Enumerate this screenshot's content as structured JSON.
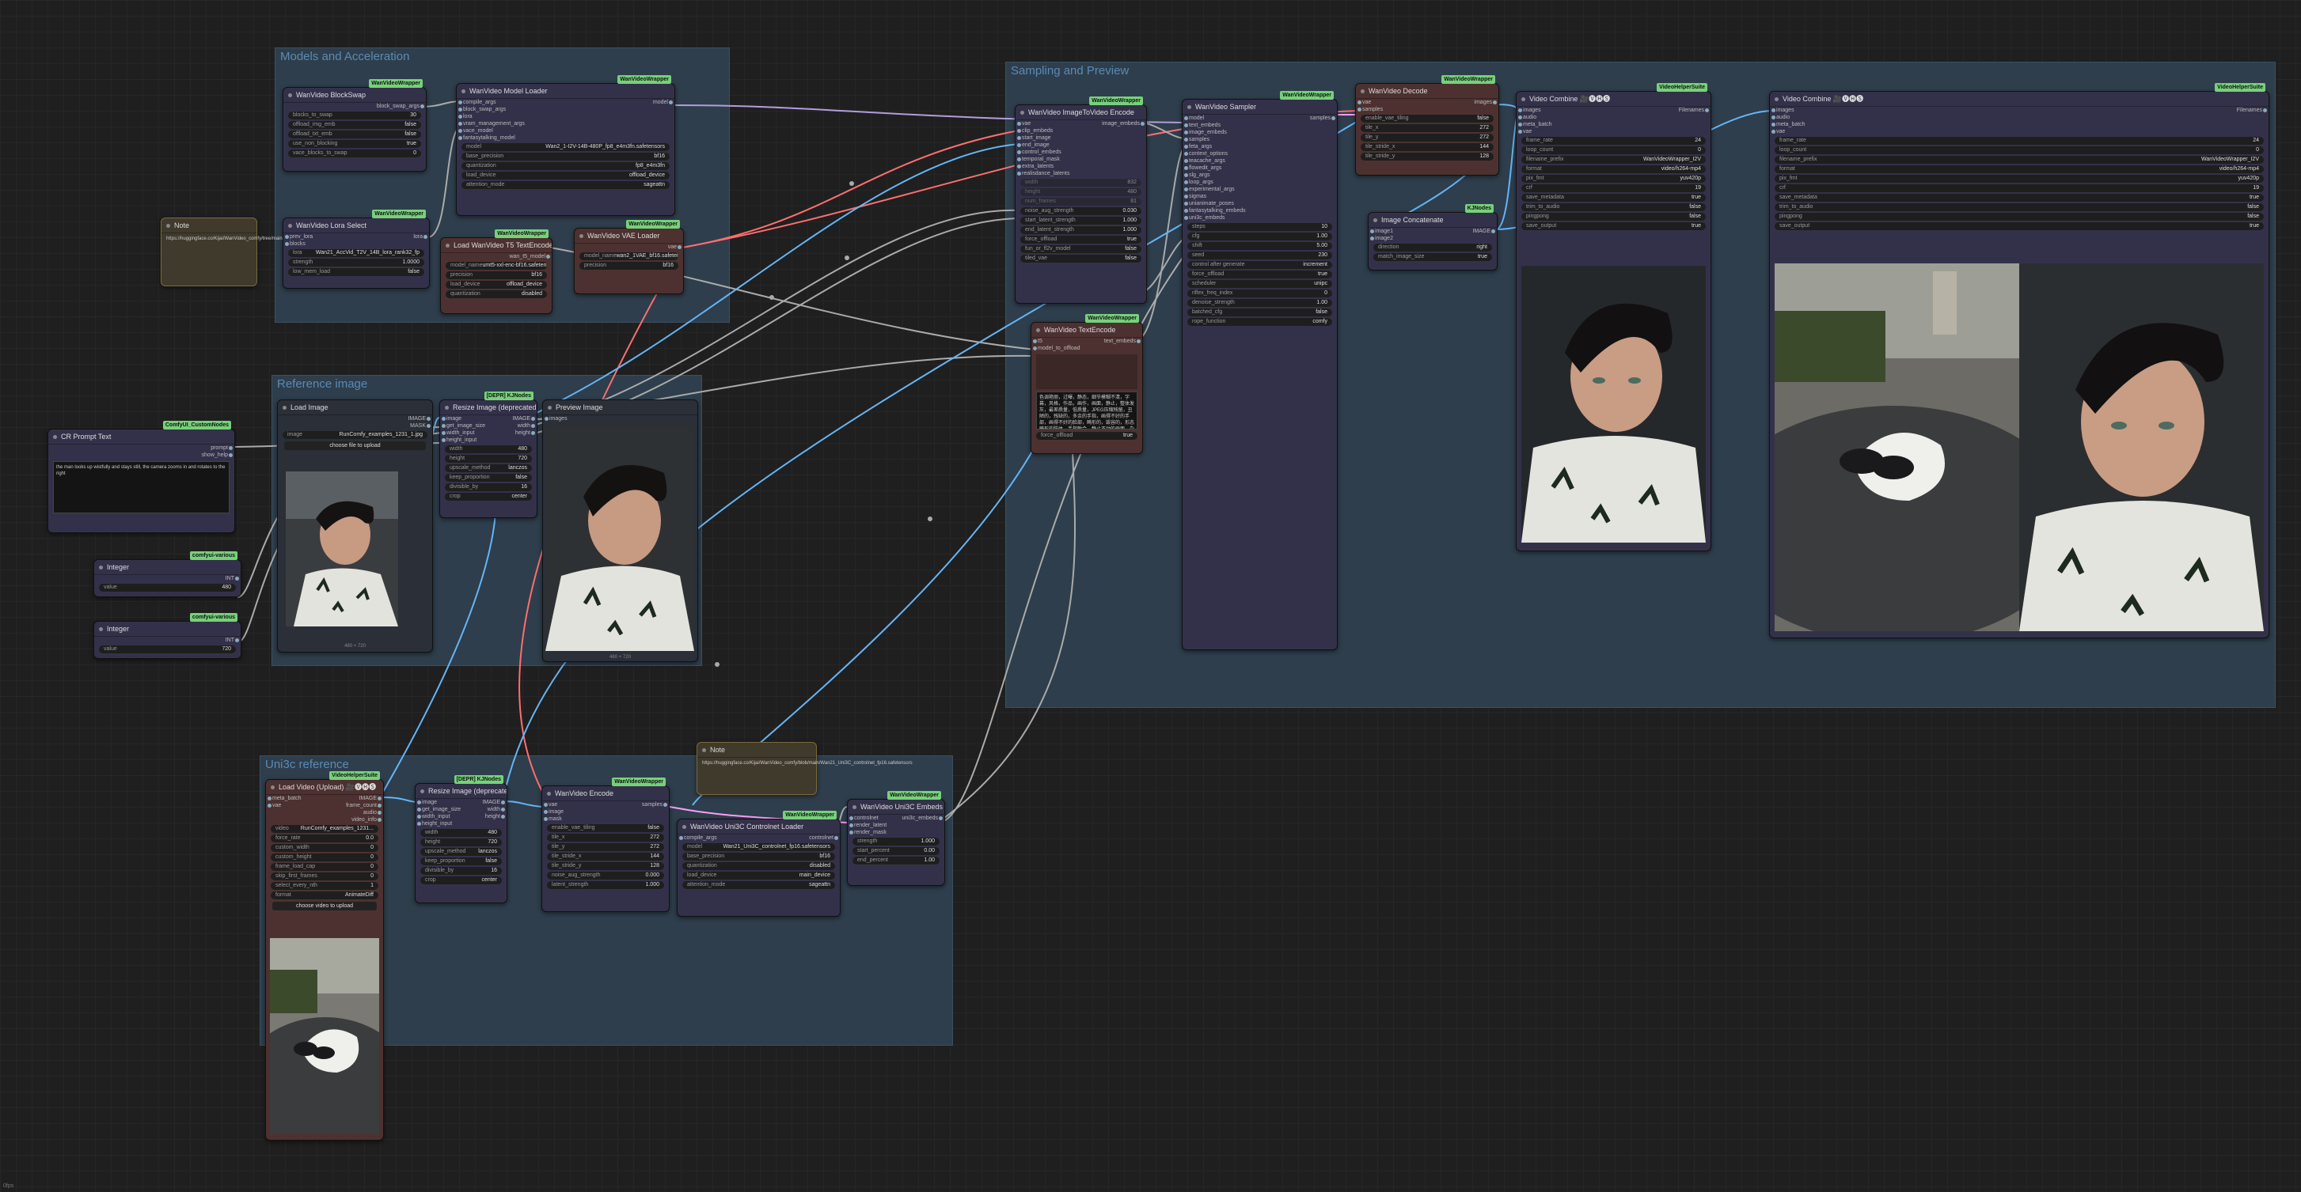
{
  "canvas": {
    "corner_label": "0fps"
  },
  "groups": {
    "models": "Models and Acceleration",
    "reference": "Reference image",
    "sampling": "Sampling and Preview",
    "uni3c": "Uni3c reference"
  },
  "nodes": {
    "blockswap": {
      "title": "WanVideo BlockSwap",
      "badge": "WanVideoWrapper",
      "output": "block_swap_args",
      "widgets": [
        [
          "blocks_to_swap",
          "30"
        ],
        [
          "offload_img_emb",
          "false"
        ],
        [
          "offload_txt_emb",
          "false"
        ],
        [
          "use_non_blocking",
          "true"
        ],
        [
          "vace_blocks_to_swap",
          "0"
        ]
      ]
    },
    "model_loader": {
      "title": "WanVideo Model Loader",
      "badge": "WanVideoWrapper",
      "output": "model",
      "inputs": [
        "compile_args",
        "block_swap_args",
        "lora",
        "vram_management_args",
        "vace_model",
        "fantasytalking_model"
      ],
      "widgets": [
        [
          "model",
          "Wan2_1-I2V-14B-480P_fp8_e4m3fn.safetensors"
        ],
        [
          "base_precision",
          "bf16"
        ],
        [
          "quantization",
          "fp8_e4m3fn"
        ],
        [
          "load_device",
          "offload_device"
        ],
        [
          "attention_mode",
          "sageattn"
        ]
      ]
    },
    "lora": {
      "title": "WanVideo Lora Select",
      "badge": "WanVideoWrapper",
      "output": "lora",
      "inputs": [
        "prev_lora",
        "blocks"
      ],
      "widgets": [
        [
          "lora",
          "Wan21_AccVid_T2V_14B_lora_rank32_fp"
        ],
        [
          "strength",
          "1.0000"
        ],
        [
          "low_mem_load",
          "false"
        ]
      ]
    },
    "note1": {
      "title": "Note",
      "text": "https://huggingface.co/Kijai/WanVideo_comfy/tree/main"
    },
    "t5": {
      "title": "Load WanVideo T5 TextEncoder",
      "badge": "WanVideoWrapper",
      "output": "wan_t5_model",
      "widgets": [
        [
          "model_name",
          "umt5-xxl-enc-bf16.safetens"
        ],
        [
          "precision",
          "bf16"
        ],
        [
          "load_device",
          "offload_device"
        ],
        [
          "quantization",
          "disabled"
        ]
      ]
    },
    "vae": {
      "title": "WanVideo VAE Loader",
      "badge": "WanVideoWrapper",
      "output": "vae",
      "widgets": [
        [
          "model_name",
          "wan2_1VAE_bf16.safetensors"
        ],
        [
          "precision",
          "bf16"
        ]
      ]
    },
    "prompt": {
      "title": "CR Prompt Text",
      "badge": "ComfyUI_CustomNodes",
      "outputs": [
        "prompt",
        "show_help"
      ],
      "text": "the man looks up wistfully and stays still, the camera zooms in and rotates to the right"
    },
    "int1": {
      "title": "Integer",
      "badge": "comfyui-various",
      "output": "INT",
      "widgets": [
        [
          "value",
          "480"
        ]
      ]
    },
    "int2": {
      "title": "Integer",
      "badge": "comfyui-various",
      "output": "INT",
      "widgets": [
        [
          "value",
          "720"
        ]
      ]
    },
    "load_image": {
      "title": "Load Image",
      "outputs": [
        "IMAGE",
        "MASK"
      ],
      "widgets": [
        [
          "image",
          "RunComfy_examples_1231_1.jpg"
        ]
      ],
      "upload": "choose file to upload",
      "caption": "480 × 720"
    },
    "resize": {
      "title": "Resize Image (deprecated)",
      "badge": "[DEPR] KJNodes",
      "inputs": [
        "image",
        "get_image_size",
        "width_input",
        "height_input"
      ],
      "outputs": [
        "IMAGE",
        "width",
        "height"
      ],
      "widgets": [
        [
          "width",
          "480"
        ],
        [
          "height",
          "720"
        ],
        [
          "upscale_method",
          "lanczos"
        ],
        [
          "keep_proportion",
          "false"
        ],
        [
          "divisible_by",
          "16"
        ],
        [
          "crop",
          "center"
        ]
      ]
    },
    "preview": {
      "title": "Preview Image",
      "inputs": [
        "images"
      ],
      "caption": "480 × 720"
    },
    "i2v_encode": {
      "title": "WanVideo ImageToVideo Encode",
      "badge": "WanVideoWrapper",
      "output": "image_embeds",
      "inputs": [
        "vae",
        "clip_embeds",
        "start_image",
        "end_image",
        "control_embeds",
        "temporal_mask",
        "extra_latents",
        "realisdance_latents"
      ],
      "widgets": [
        [
          "width",
          "832"
        ],
        [
          "height",
          "480"
        ],
        [
          "num_frames",
          "81"
        ],
        [
          "noise_aug_strength",
          "0.030"
        ],
        [
          "start_latent_strength",
          "1.000"
        ],
        [
          "end_latent_strength",
          "1.000"
        ],
        [
          "force_offload",
          "true"
        ],
        [
          "fun_or_fl2v_model",
          "false"
        ],
        [
          "tiled_vae",
          "false"
        ]
      ]
    },
    "text_encode": {
      "title": "WanVideo TextEncode",
      "badge": "WanVideoWrapper",
      "output": "text_embeds",
      "inputs": [
        "t5",
        "model_to_offload"
      ],
      "negative": "色调艳丽，过曝，静态，细节模糊不清，字幕，风格，作品，画作，画面，静止，整体发灰，最差质量，低质量，JPEG压缩残留，丑陋的，残缺的，多余的手指，画得不好的手部，画得不好的脸部，畸形的，毁容的，形态畸形的肢体，手指融合，静止不动的画面，杂乱的背景，三条腿，背景人很多，倒着走",
      "widgets": [
        [
          "force_offload",
          "true"
        ]
      ]
    },
    "sampler": {
      "title": "WanVideo Sampler",
      "badge": "WanVideoWrapper",
      "output": "samples",
      "inputs": [
        "model",
        "text_embeds",
        "image_embeds",
        "samples",
        "feta_args",
        "context_options",
        "teacache_args",
        "flowedit_args",
        "slg_args",
        "loop_args",
        "experimental_args",
        "sigmas",
        "unianimate_poses",
        "fantasytalking_embeds",
        "uni3c_embeds"
      ],
      "widgets": [
        [
          "steps",
          "10"
        ],
        [
          "cfg",
          "1.00"
        ],
        [
          "shift",
          "5.00"
        ],
        [
          "seed",
          "230"
        ],
        [
          "control after generate",
          "increment"
        ],
        [
          "force_offload",
          "true"
        ],
        [
          "scheduler",
          "unipc"
        ],
        [
          "riflex_freq_index",
          "0"
        ],
        [
          "denoise_strength",
          "1.00"
        ],
        [
          "batched_cfg",
          "false"
        ],
        [
          "rope_function",
          "comfy"
        ]
      ]
    },
    "decode": {
      "title": "WanVideo Decode",
      "badge": "WanVideoWrapper",
      "output": "images",
      "inputs": [
        "vae",
        "samples"
      ],
      "widgets": [
        [
          "enable_vae_tiling",
          "false"
        ],
        [
          "tile_x",
          "272"
        ],
        [
          "tile_y",
          "272"
        ],
        [
          "tile_stride_x",
          "144"
        ],
        [
          "tile_stride_y",
          "128"
        ]
      ]
    },
    "concat": {
      "title": "Image Concatenate",
      "badge": "KJNodes",
      "output": "IMAGE",
      "inputs": [
        "image1",
        "image2"
      ],
      "widgets": [
        [
          "direction",
          "right"
        ],
        [
          "match_image_size",
          "true"
        ]
      ]
    },
    "combine1": {
      "title": "Video Combine 🎥🅥🅗🅢",
      "badge": "VideoHelperSuite",
      "output": "Filenames",
      "inputs": [
        "images",
        "audio",
        "meta_batch",
        "vae"
      ],
      "widgets": [
        [
          "frame_rate",
          "24"
        ],
        [
          "loop_count",
          "0"
        ],
        [
          "filename_prefix",
          "WanVideoWrapper_I2V"
        ],
        [
          "format",
          "video/h264-mp4"
        ],
        [
          "pix_fmt",
          "yuv420p"
        ],
        [
          "crf",
          "19"
        ],
        [
          "save_metadata",
          "true"
        ],
        [
          "trim_to_audio",
          "false"
        ],
        [
          "pingpong",
          "false"
        ],
        [
          "save_output",
          "true"
        ]
      ]
    },
    "combine2": {
      "title": "Video Combine 🎥🅥🅗🅢",
      "badge": "VideoHelperSuite",
      "output": "Filenames",
      "inputs": [
        "images",
        "audio",
        "meta_batch",
        "vae"
      ],
      "widgets": [
        [
          "frame_rate",
          "24"
        ],
        [
          "loop_count",
          "0"
        ],
        [
          "filename_prefix",
          "WanVideoWrapper_I2V"
        ],
        [
          "format",
          "video/h264-mp4"
        ],
        [
          "pix_fmt",
          "yuv420p"
        ],
        [
          "crf",
          "19"
        ],
        [
          "save_metadata",
          "true"
        ],
        [
          "trim_to_audio",
          "false"
        ],
        [
          "pingpong",
          "false"
        ],
        [
          "save_output",
          "true"
        ]
      ]
    },
    "load_video": {
      "title": "Load Video (Upload) 🎥🅥🅗🅢",
      "badge": "VideoHelperSuite",
      "inputs": [
        "meta_batch",
        "vae"
      ],
      "outputs": [
        "IMAGE",
        "frame_count",
        "audio",
        "video_info"
      ],
      "widgets": [
        [
          "video",
          "RunComfy_examples_1231..."
        ],
        [
          "force_rate",
          "0.0"
        ],
        [
          "custom_width",
          "0"
        ],
        [
          "custom_height",
          "0"
        ],
        [
          "frame_load_cap",
          "0"
        ],
        [
          "skip_first_frames",
          "0"
        ],
        [
          "select_every_nth",
          "1"
        ],
        [
          "format",
          "AnimateDiff"
        ]
      ],
      "upload": "choose video to upload"
    },
    "resize2": {
      "title": "Resize Image (deprecated)",
      "badge": "[DEPR] KJNodes",
      "inputs": [
        "image",
        "get_image_size",
        "width_input",
        "height_input"
      ],
      "outputs": [
        "IMAGE",
        "width",
        "height"
      ],
      "widgets": [
        [
          "width",
          "480"
        ],
        [
          "height",
          "720"
        ],
        [
          "upscale_method",
          "lanczos"
        ],
        [
          "keep_proportion",
          "false"
        ],
        [
          "divisible_by",
          "16"
        ],
        [
          "crop",
          "center"
        ]
      ]
    },
    "wv_encode": {
      "title": "WanVideo Encode",
      "badge": "WanVideoWrapper",
      "output": "samples",
      "inputs": [
        "vae",
        "image",
        "mask"
      ],
      "widgets": [
        [
          "enable_vae_tiling",
          "false"
        ],
        [
          "tile_x",
          "272"
        ],
        [
          "tile_y",
          "272"
        ],
        [
          "tile_stride_x",
          "144"
        ],
        [
          "tile_stride_y",
          "128"
        ],
        [
          "noise_aug_strength",
          "0.000"
        ],
        [
          "latent_strength",
          "1.000"
        ]
      ]
    },
    "note2": {
      "title": "Note",
      "text": "https://huggingface.co/Kijai/WanVideo_comfy/blob/main/Wan21_Uni3C_controlnet_fp16.safetensors"
    },
    "uni3c_loader": {
      "title": "WanVideo Uni3C Controlnet Loader",
      "badge": "WanVideoWrapper",
      "output": "controlnet",
      "inputs": [
        "compile_args"
      ],
      "widgets": [
        [
          "model",
          "Wan21_Uni3C_controlnet_fp16.safetensors"
        ],
        [
          "base_precision",
          "bf16"
        ],
        [
          "quantization",
          "disabled"
        ],
        [
          "load_device",
          "main_device"
        ],
        [
          "attention_mode",
          "sageattn"
        ]
      ]
    },
    "uni3c_embeds": {
      "title": "WanVideo Uni3C Embeds",
      "badge": "WanVideoWrapper",
      "output": "uni3c_embeds",
      "inputs": [
        "controlnet",
        "render_latent",
        "render_mask"
      ],
      "widgets": [
        [
          "strength",
          "1.000"
        ],
        [
          "start_percent",
          "0.00"
        ],
        [
          "end_percent",
          "1.00"
        ]
      ]
    }
  },
  "wire_colors": {
    "image": "#64b5f6",
    "vae": "#ff6e6e",
    "model": "#b39ddb",
    "latent": "#ff9cf9",
    "default": "#aaaaaa"
  }
}
